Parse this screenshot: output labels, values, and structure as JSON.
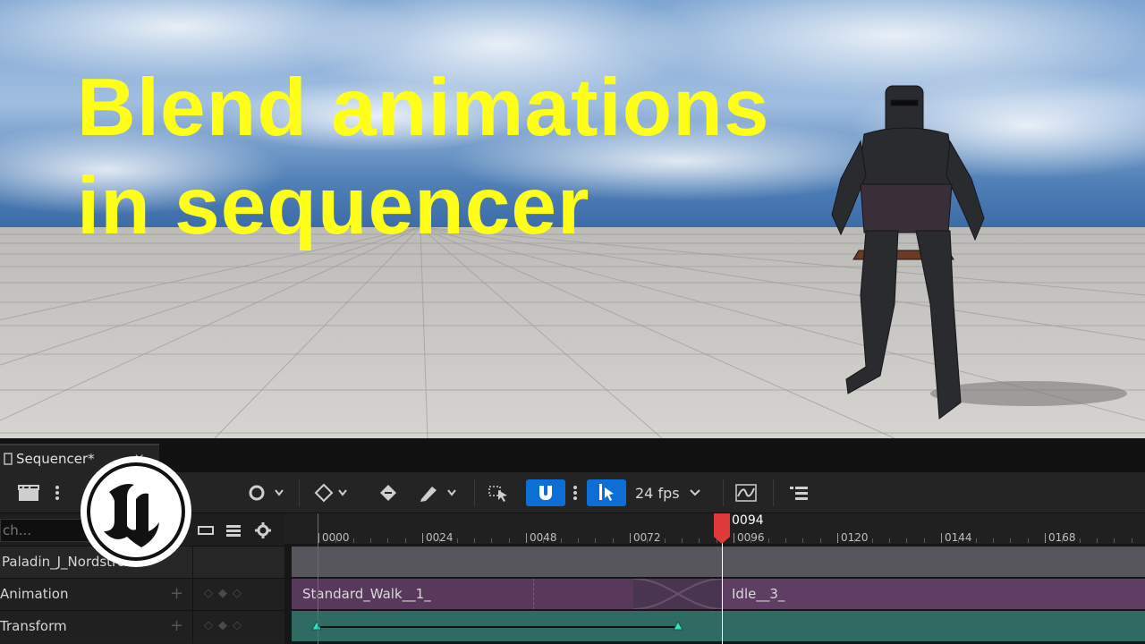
{
  "headline": {
    "line1": "Blend animations",
    "line2": "in sequencer"
  },
  "tab": {
    "label": "Sequencer*",
    "close": "×"
  },
  "toolbar": {
    "fps_label": "24 fps"
  },
  "search": {
    "placeholder": "ch..."
  },
  "tracks": [
    {
      "name": "Paladin_J_Nordstrom"
    },
    {
      "name": "Animation"
    },
    {
      "name": "Transform"
    }
  ],
  "left_controls": {
    "plus": "+",
    "keys": "◇◆◇"
  },
  "ruler": {
    "ticks": [
      "0000",
      "0024",
      "0048",
      "0072",
      "0096",
      "0120",
      "0144",
      "0168"
    ],
    "playhead_frame": "0094"
  },
  "sections": {
    "walk": "Standard_Walk__1_",
    "idle": "Idle__3_"
  },
  "colors": {
    "headline": "#ffff1a",
    "accent_blue": "#0d6fd6",
    "playhead": "#e03a3a",
    "anim_section": "#5a3a5e",
    "transform_section": "#2f6a63",
    "actor_row": "#5a5a60"
  }
}
